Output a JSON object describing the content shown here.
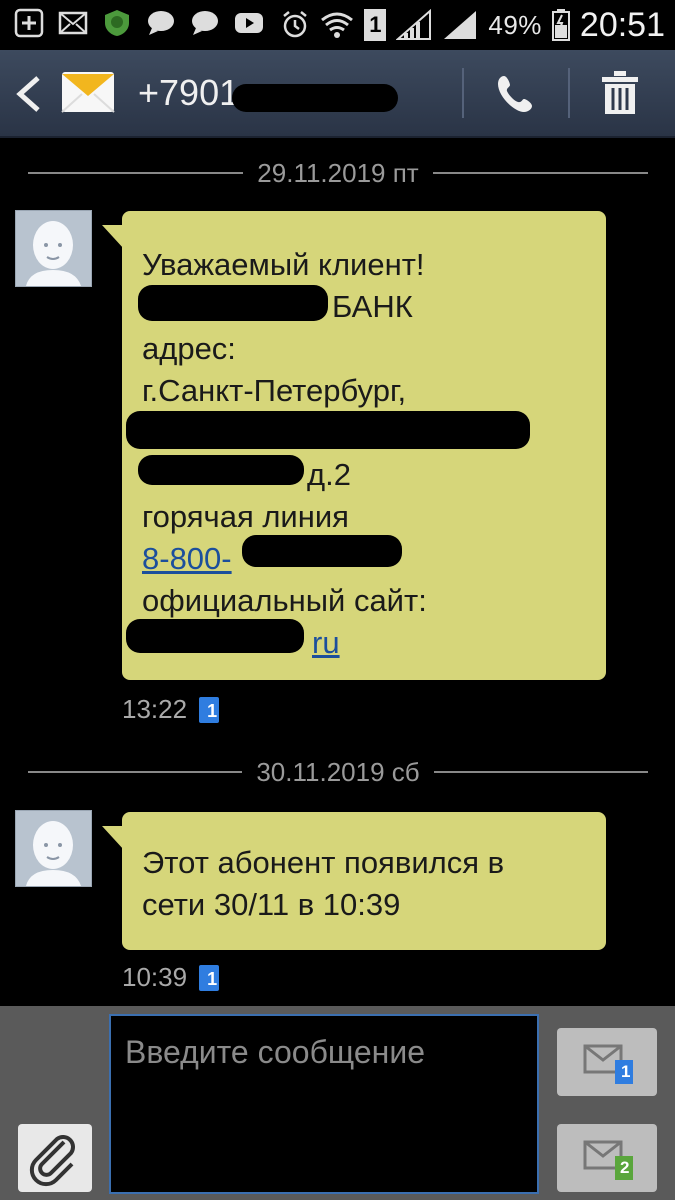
{
  "status_bar": {
    "icons_left": [
      "add-icon",
      "mail-icon",
      "shield-icon",
      "chat-icon",
      "chat-icon",
      "video-icon"
    ],
    "icons_right": [
      "alarm-icon",
      "wifi-icon",
      "sim1-icon",
      "signal-icon",
      "signal-icon",
      "battery-icon"
    ],
    "sim_label": "1",
    "battery": "49%",
    "time": "20:51"
  },
  "header": {
    "contact": "+7901",
    "icons": [
      "back-icon",
      "envelope-icon",
      "phone-icon",
      "trash-icon"
    ]
  },
  "conversation": [
    {
      "date": "29.11.2019 пт",
      "lines": [
        {
          "text": "Уважаемый клиент!"
        },
        {
          "text": "БАНК"
        },
        {
          "text": "адрес:"
        },
        {
          "text": "г.Санкт-Петербург,"
        },
        {
          "text": ""
        },
        {
          "text": "д.2"
        },
        {
          "text": "горячая линия"
        },
        {
          "text": "8-800-"
        },
        {
          "text": "официальный сайт:"
        },
        {
          "text": "ru"
        }
      ],
      "time": "13:22",
      "sim": "1"
    },
    {
      "date": "30.11.2019 сб",
      "lines": [
        {
          "text": "Этот абонент появился в"
        },
        {
          "text": "сети 30/11 в 10:39"
        }
      ],
      "time": "10:39",
      "sim": "1"
    }
  ],
  "compose": {
    "placeholder": "Введите сообщение",
    "send_sim1_label": "1",
    "send_sim2_label": "2"
  },
  "colors": {
    "bubble": "#d6d67a",
    "header": "#2f3a4d",
    "link": "#1c4f9c",
    "sim_badge": "#2f7de0",
    "sim2_badge": "#5aa63c"
  }
}
